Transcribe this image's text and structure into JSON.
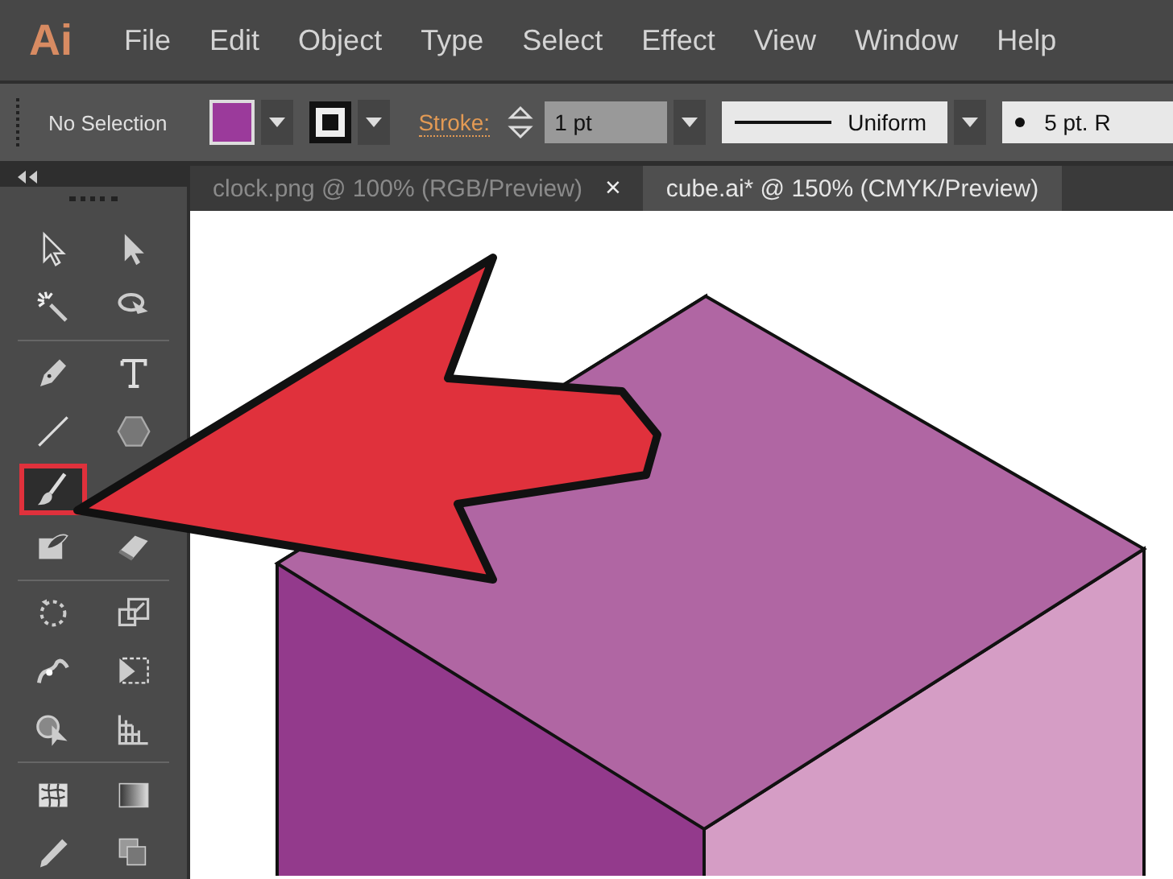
{
  "app": {
    "logo": "Ai"
  },
  "menu": [
    "File",
    "Edit",
    "Object",
    "Type",
    "Select",
    "Effect",
    "View",
    "Window",
    "Help"
  ],
  "control_bar": {
    "selection": "No Selection",
    "stroke_label": "Stroke:",
    "stroke_weight": "1 pt",
    "profile": "Uniform",
    "brush": "5 pt. R"
  },
  "tabs": [
    {
      "label": "clock.png @ 100% (RGB/Preview)",
      "close": "×",
      "selected": false
    },
    {
      "label": "cube.ai* @ 150% (CMYK/Preview)",
      "selected": true
    }
  ],
  "tools": [
    {
      "selected": false
    },
    {
      "selected": false
    },
    {
      "selected": false
    },
    {
      "selected": false
    },
    {
      "selected": false
    },
    {
      "selected": false
    },
    {
      "selected": false
    },
    {
      "selected": false
    },
    {
      "selected": true
    },
    {
      "selected": false
    },
    {
      "selected": false
    },
    {
      "selected": false
    },
    {
      "selected": false
    },
    {
      "selected": false
    },
    {
      "selected": false
    },
    {
      "selected": false
    },
    {
      "selected": false
    },
    {
      "selected": false
    },
    {
      "selected": false
    },
    {
      "selected": false
    },
    {
      "selected": false
    }
  ]
}
